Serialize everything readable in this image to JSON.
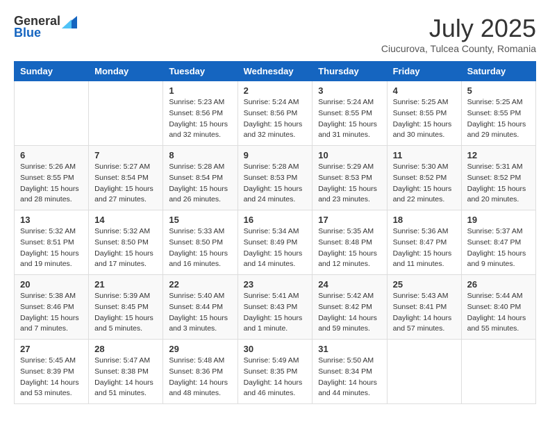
{
  "logo": {
    "general": "General",
    "blue": "Blue"
  },
  "title": {
    "month": "July 2025",
    "location": "Ciucurova, Tulcea County, Romania"
  },
  "headers": [
    "Sunday",
    "Monday",
    "Tuesday",
    "Wednesday",
    "Thursday",
    "Friday",
    "Saturday"
  ],
  "weeks": [
    [
      {
        "day": "",
        "details": ""
      },
      {
        "day": "",
        "details": ""
      },
      {
        "day": "1",
        "details": "Sunrise: 5:23 AM\nSunset: 8:56 PM\nDaylight: 15 hours\nand 32 minutes."
      },
      {
        "day": "2",
        "details": "Sunrise: 5:24 AM\nSunset: 8:56 PM\nDaylight: 15 hours\nand 32 minutes."
      },
      {
        "day": "3",
        "details": "Sunrise: 5:24 AM\nSunset: 8:55 PM\nDaylight: 15 hours\nand 31 minutes."
      },
      {
        "day": "4",
        "details": "Sunrise: 5:25 AM\nSunset: 8:55 PM\nDaylight: 15 hours\nand 30 minutes."
      },
      {
        "day": "5",
        "details": "Sunrise: 5:25 AM\nSunset: 8:55 PM\nDaylight: 15 hours\nand 29 minutes."
      }
    ],
    [
      {
        "day": "6",
        "details": "Sunrise: 5:26 AM\nSunset: 8:55 PM\nDaylight: 15 hours\nand 28 minutes."
      },
      {
        "day": "7",
        "details": "Sunrise: 5:27 AM\nSunset: 8:54 PM\nDaylight: 15 hours\nand 27 minutes."
      },
      {
        "day": "8",
        "details": "Sunrise: 5:28 AM\nSunset: 8:54 PM\nDaylight: 15 hours\nand 26 minutes."
      },
      {
        "day": "9",
        "details": "Sunrise: 5:28 AM\nSunset: 8:53 PM\nDaylight: 15 hours\nand 24 minutes."
      },
      {
        "day": "10",
        "details": "Sunrise: 5:29 AM\nSunset: 8:53 PM\nDaylight: 15 hours\nand 23 minutes."
      },
      {
        "day": "11",
        "details": "Sunrise: 5:30 AM\nSunset: 8:52 PM\nDaylight: 15 hours\nand 22 minutes."
      },
      {
        "day": "12",
        "details": "Sunrise: 5:31 AM\nSunset: 8:52 PM\nDaylight: 15 hours\nand 20 minutes."
      }
    ],
    [
      {
        "day": "13",
        "details": "Sunrise: 5:32 AM\nSunset: 8:51 PM\nDaylight: 15 hours\nand 19 minutes."
      },
      {
        "day": "14",
        "details": "Sunrise: 5:32 AM\nSunset: 8:50 PM\nDaylight: 15 hours\nand 17 minutes."
      },
      {
        "day": "15",
        "details": "Sunrise: 5:33 AM\nSunset: 8:50 PM\nDaylight: 15 hours\nand 16 minutes."
      },
      {
        "day": "16",
        "details": "Sunrise: 5:34 AM\nSunset: 8:49 PM\nDaylight: 15 hours\nand 14 minutes."
      },
      {
        "day": "17",
        "details": "Sunrise: 5:35 AM\nSunset: 8:48 PM\nDaylight: 15 hours\nand 12 minutes."
      },
      {
        "day": "18",
        "details": "Sunrise: 5:36 AM\nSunset: 8:47 PM\nDaylight: 15 hours\nand 11 minutes."
      },
      {
        "day": "19",
        "details": "Sunrise: 5:37 AM\nSunset: 8:47 PM\nDaylight: 15 hours\nand 9 minutes."
      }
    ],
    [
      {
        "day": "20",
        "details": "Sunrise: 5:38 AM\nSunset: 8:46 PM\nDaylight: 15 hours\nand 7 minutes."
      },
      {
        "day": "21",
        "details": "Sunrise: 5:39 AM\nSunset: 8:45 PM\nDaylight: 15 hours\nand 5 minutes."
      },
      {
        "day": "22",
        "details": "Sunrise: 5:40 AM\nSunset: 8:44 PM\nDaylight: 15 hours\nand 3 minutes."
      },
      {
        "day": "23",
        "details": "Sunrise: 5:41 AM\nSunset: 8:43 PM\nDaylight: 15 hours\nand 1 minute."
      },
      {
        "day": "24",
        "details": "Sunrise: 5:42 AM\nSunset: 8:42 PM\nDaylight: 14 hours\nand 59 minutes."
      },
      {
        "day": "25",
        "details": "Sunrise: 5:43 AM\nSunset: 8:41 PM\nDaylight: 14 hours\nand 57 minutes."
      },
      {
        "day": "26",
        "details": "Sunrise: 5:44 AM\nSunset: 8:40 PM\nDaylight: 14 hours\nand 55 minutes."
      }
    ],
    [
      {
        "day": "27",
        "details": "Sunrise: 5:45 AM\nSunset: 8:39 PM\nDaylight: 14 hours\nand 53 minutes."
      },
      {
        "day": "28",
        "details": "Sunrise: 5:47 AM\nSunset: 8:38 PM\nDaylight: 14 hours\nand 51 minutes."
      },
      {
        "day": "29",
        "details": "Sunrise: 5:48 AM\nSunset: 8:36 PM\nDaylight: 14 hours\nand 48 minutes."
      },
      {
        "day": "30",
        "details": "Sunrise: 5:49 AM\nSunset: 8:35 PM\nDaylight: 14 hours\nand 46 minutes."
      },
      {
        "day": "31",
        "details": "Sunrise: 5:50 AM\nSunset: 8:34 PM\nDaylight: 14 hours\nand 44 minutes."
      },
      {
        "day": "",
        "details": ""
      },
      {
        "day": "",
        "details": ""
      }
    ]
  ]
}
